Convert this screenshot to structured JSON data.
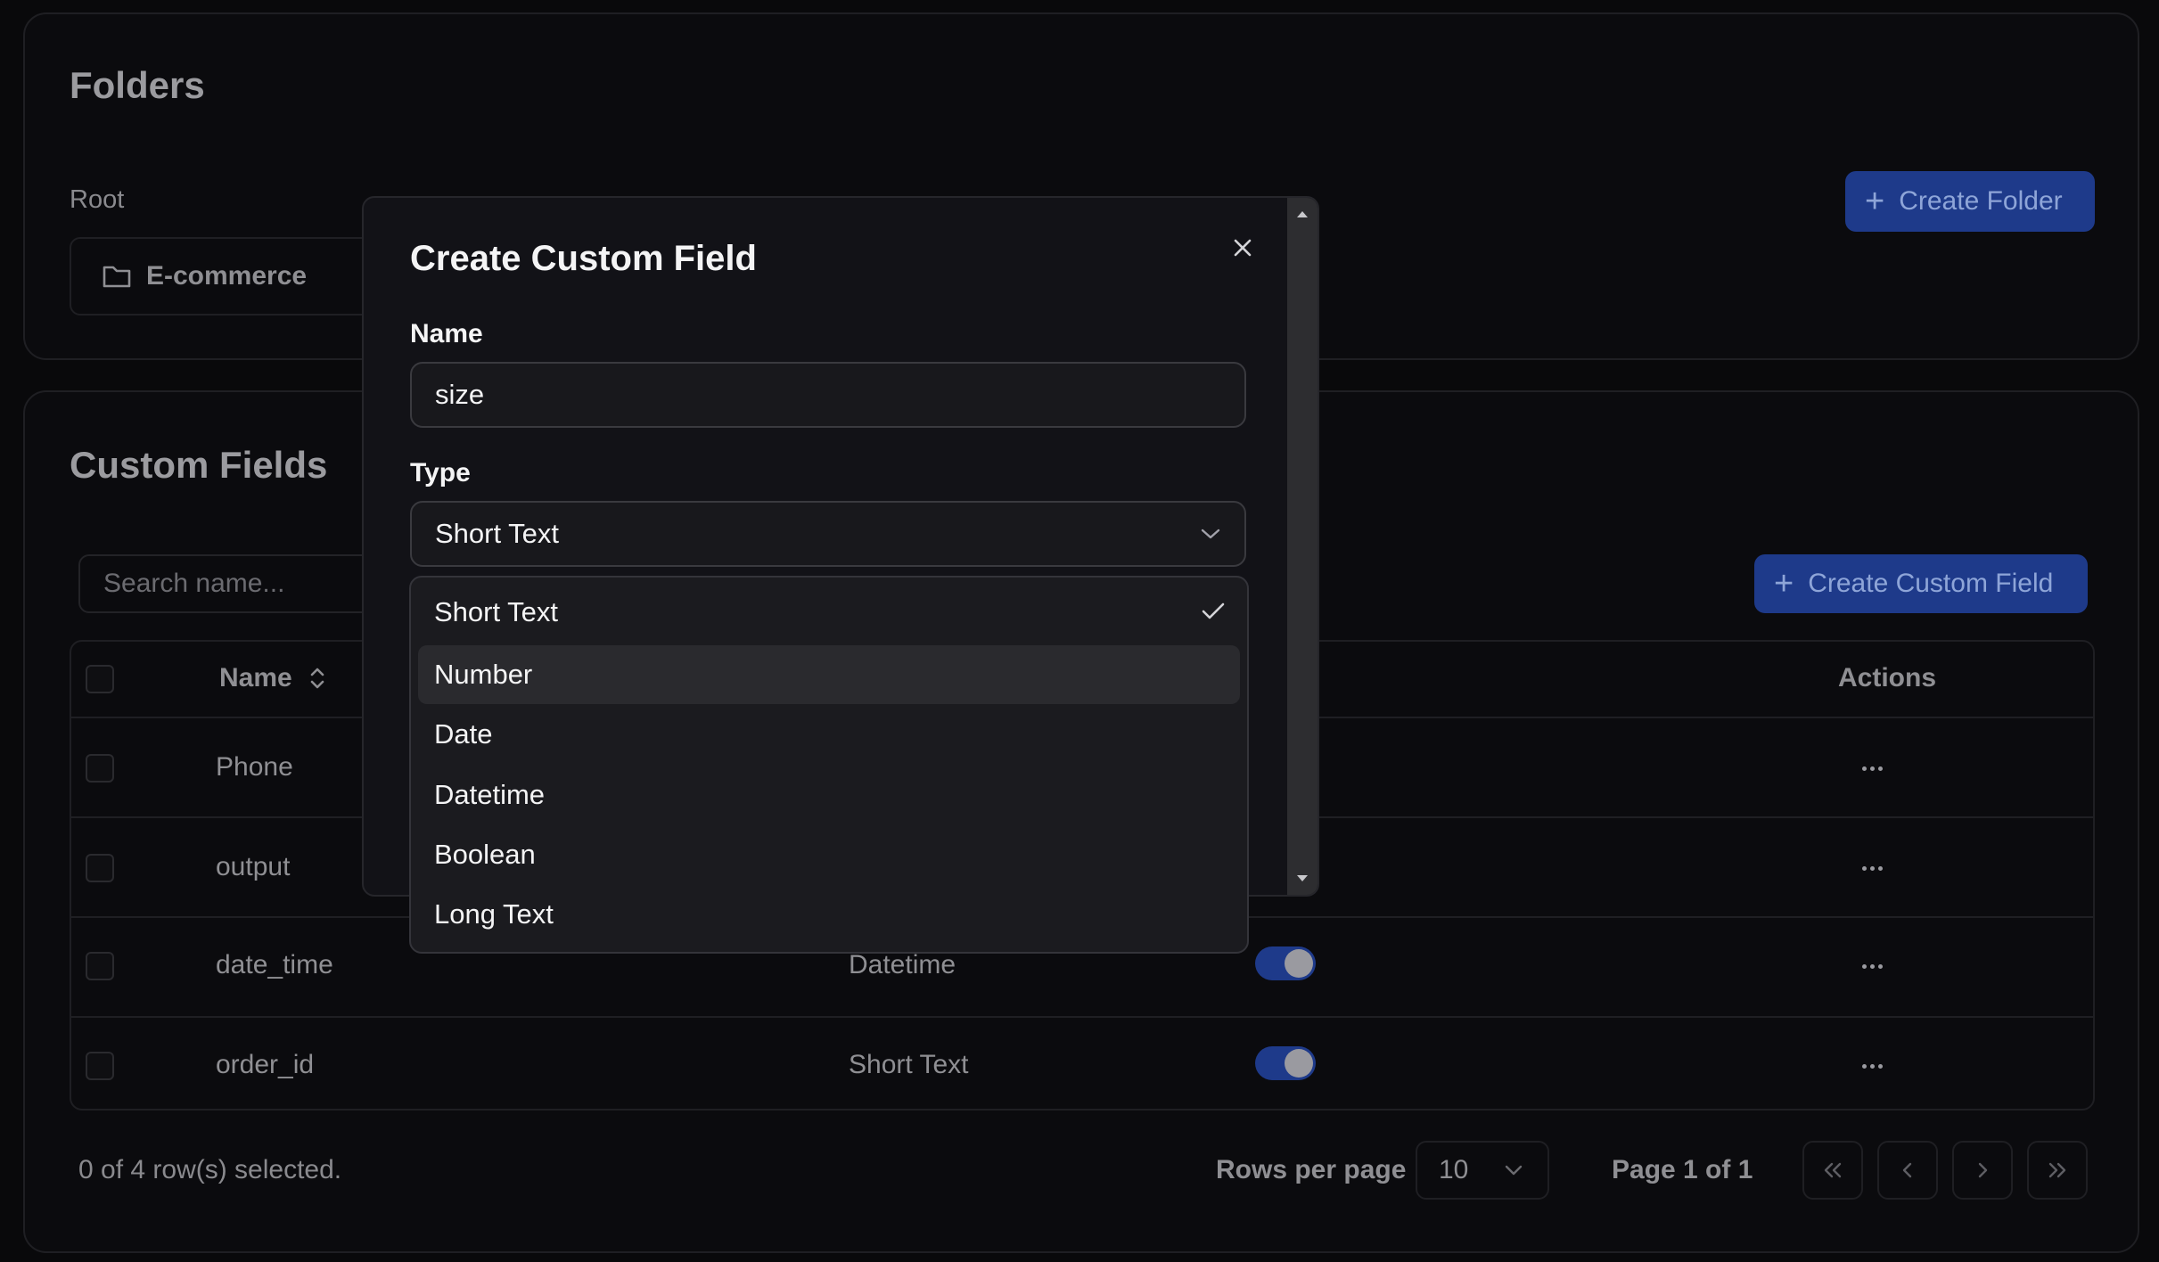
{
  "folders": {
    "title": "Folders",
    "breadcrumb": "Root",
    "create_button": "Create Folder",
    "items": [
      {
        "label": "E-commerce",
        "icon": "folder-icon"
      }
    ]
  },
  "custom_fields": {
    "title": "Custom Fields",
    "search_placeholder": "Search name...",
    "create_button": "Create Custom Field",
    "table": {
      "headers": {
        "name": "Name",
        "actions": "Actions"
      },
      "rows": [
        {
          "name": "Phone",
          "type": "",
          "enabled": true
        },
        {
          "name": "output",
          "type": "",
          "enabled": true
        },
        {
          "name": "date_time",
          "type": "Datetime",
          "enabled": true
        },
        {
          "name": "order_id",
          "type": "Short Text",
          "enabled": true
        }
      ]
    },
    "footer": {
      "selection": "0 of 4 row(s) selected.",
      "rows_per_page_label": "Rows per page",
      "rows_per_page_value": "10",
      "page_info": "Page 1 of 1"
    }
  },
  "modal": {
    "title": "Create Custom Field",
    "name_label": "Name",
    "name_value": "size",
    "type_label": "Type",
    "type_value": "Short Text",
    "type_options": [
      "Short Text",
      "Number",
      "Date",
      "Datetime",
      "Boolean",
      "Long Text"
    ],
    "selected_option": "Short Text",
    "hovered_option": "Number"
  },
  "colors": {
    "background": "#09090b",
    "primary_button": "#1e3a8a",
    "toggle_on": "#1e3a8a",
    "modal_bg": "#121217"
  }
}
